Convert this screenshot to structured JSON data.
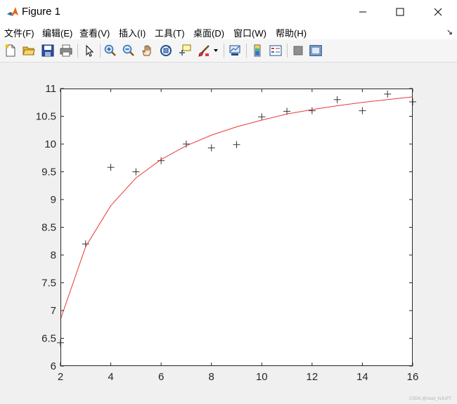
{
  "window": {
    "title": "Figure 1"
  },
  "menu": [
    "文件(F)",
    "编辑(E)",
    "查看(V)",
    "插入(I)",
    "工具(T)",
    "桌面(D)",
    "窗口(W)",
    "帮助(H)"
  ],
  "toolbar": [
    "new-figure-icon",
    "open-file-icon",
    "save-icon",
    "print-icon",
    "pointer-icon",
    "zoom-in-icon",
    "zoom-out-icon",
    "pan-hand-icon",
    "rotate-3d-icon",
    "data-cursor-icon",
    "brush-icon",
    "link-plot-icon",
    "colorbar-icon",
    "legend-icon",
    "hide-tools-icon",
    "show-tools-icon"
  ],
  "watermark": "CSDN @nuist_NJUPT",
  "chart_data": {
    "type": "scatter",
    "title": "",
    "xlabel": "",
    "ylabel": "",
    "xlim": [
      2,
      16
    ],
    "ylim": [
      6,
      11
    ],
    "xticks": [
      "2",
      "4",
      "6",
      "8",
      "10",
      "12",
      "14",
      "16"
    ],
    "yticks": [
      "6",
      "6.5",
      "7",
      "7.5",
      "8",
      "8.5",
      "9",
      "9.5",
      "10",
      "10.5",
      "11"
    ],
    "grid": false,
    "series": [
      {
        "marker": "+",
        "color": "#333333",
        "x": [
          2,
          3,
          4,
          5,
          6,
          7,
          8,
          9,
          10,
          11,
          12,
          13,
          14,
          15,
          16
        ],
        "y": [
          6.42,
          8.2,
          9.58,
          9.5,
          9.7,
          10.0,
          9.93,
          9.99,
          10.49,
          10.59,
          10.6,
          10.8,
          10.6,
          10.9,
          10.76
        ]
      },
      {
        "line": true,
        "color": "#e8393a",
        "x": [
          2,
          3,
          4,
          5,
          6,
          7,
          8,
          9,
          10,
          11,
          12,
          13,
          14,
          15,
          16
        ],
        "y": [
          6.84,
          8.15,
          8.89,
          9.39,
          9.72,
          9.97,
          10.16,
          10.31,
          10.43,
          10.54,
          10.62,
          10.69,
          10.75,
          10.8,
          10.85
        ]
      }
    ]
  }
}
